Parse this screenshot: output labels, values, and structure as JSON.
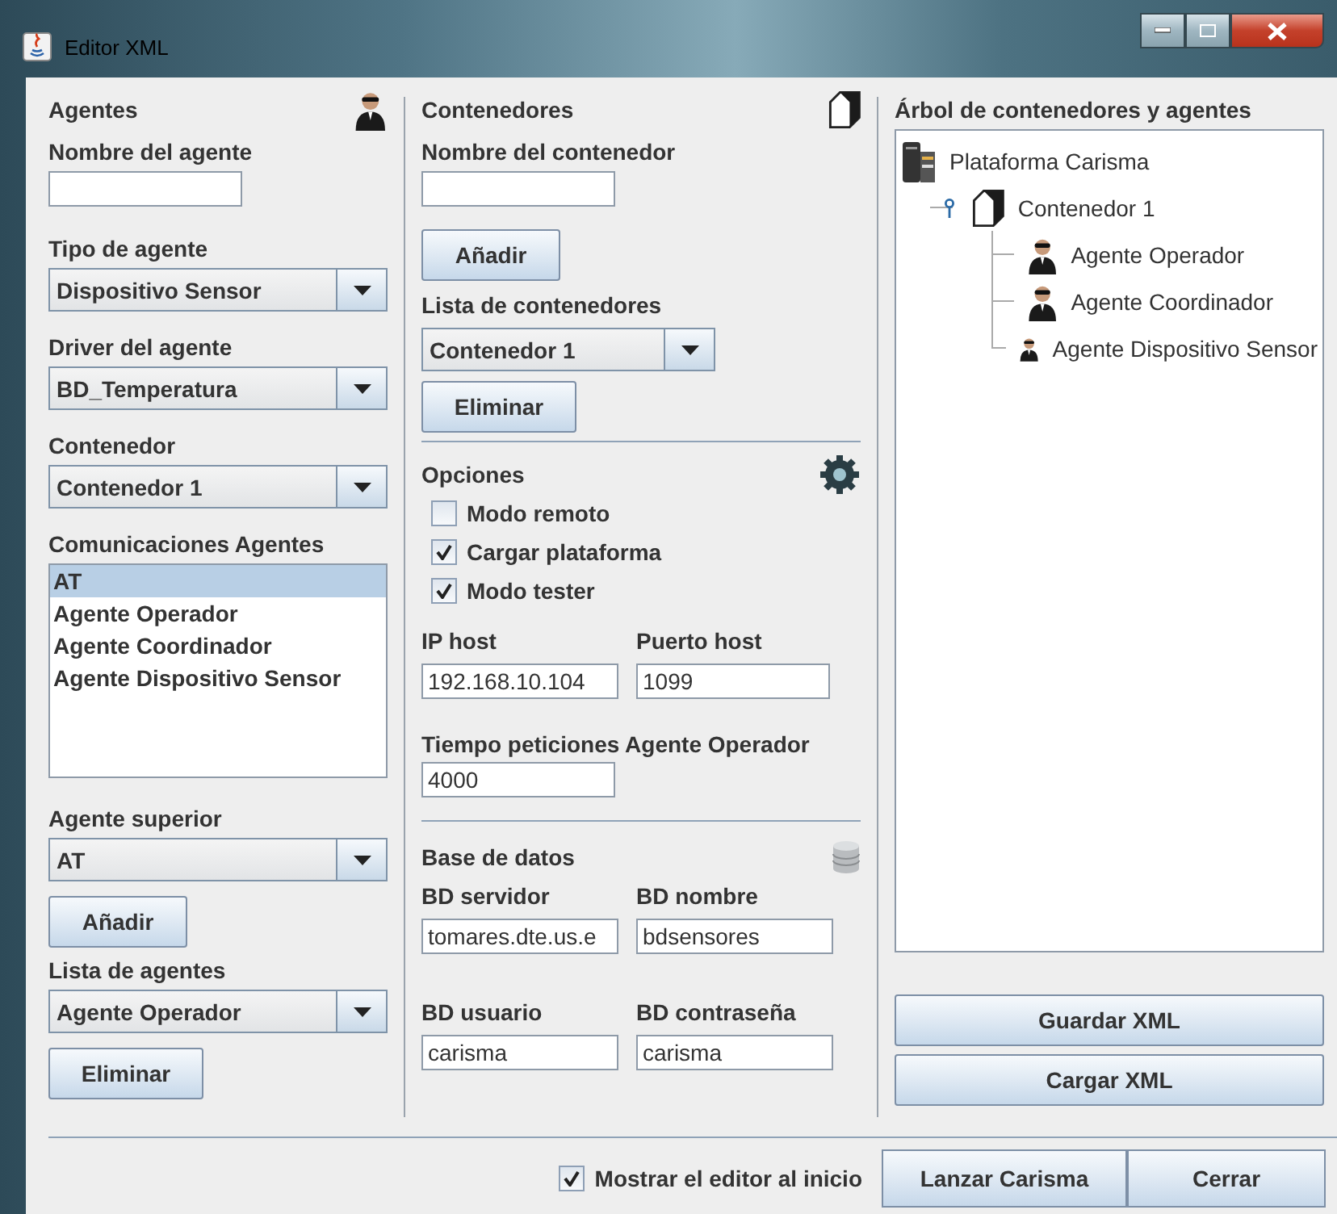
{
  "window": {
    "title": "Editor XML"
  },
  "agents": {
    "title": "Agentes",
    "name_label": "Nombre del agente",
    "type_label": "Tipo de agente",
    "type_value": "Dispositivo Sensor",
    "driver_label": "Driver del agente",
    "driver_value": "BD_Temperatura",
    "container_label": "Contenedor",
    "container_value": "Contenedor 1",
    "comms_label": "Comunicaciones Agentes",
    "comms": [
      {
        "label": "AT",
        "selected": true
      },
      {
        "label": "Agente Operador",
        "selected": false
      },
      {
        "label": "Agente Coordinador",
        "selected": false
      },
      {
        "label": "Agente Dispositivo Sensor",
        "selected": false
      }
    ],
    "superior_label": "Agente superior",
    "superior_value": "AT",
    "add_button": "Añadir",
    "list_label": "Lista de agentes",
    "list_value": "Agente Operador",
    "remove_button": "Eliminar"
  },
  "containers": {
    "title": "Contenedores",
    "name_label": "Nombre del contenedor",
    "add_button": "Añadir",
    "list_label": "Lista de contenedores",
    "list_value": "Contenedor 1",
    "remove_button": "Eliminar"
  },
  "options": {
    "title": "Opciones",
    "checks": [
      {
        "label": "Modo remoto",
        "checked": false
      },
      {
        "label": "Cargar plataforma",
        "checked": true
      },
      {
        "label": "Modo tester",
        "checked": true
      }
    ],
    "ip_label": "IP host",
    "ip_value": "192.168.10.104",
    "port_label": "Puerto host",
    "port_value": "1099",
    "timeout_label": "Tiempo peticiones Agente Operador",
    "timeout_value": "4000"
  },
  "database": {
    "title": "Base de datos",
    "fields": [
      {
        "label": "BD servidor",
        "value": "tomares.dte.us.e"
      },
      {
        "label": "BD nombre",
        "value": "bdsensores"
      },
      {
        "label": "BD usuario",
        "value": "carisma"
      },
      {
        "label": "BD contraseña",
        "value": "carisma"
      }
    ]
  },
  "tree": {
    "title": "Árbol de contenedores y agentes",
    "nodes": [
      {
        "label": "Plataforma Carisma",
        "kind": "platform",
        "children": [
          {
            "label": "Contenedor 1",
            "kind": "container",
            "expanded": true,
            "children": [
              {
                "label": "Agente Operador",
                "kind": "agent"
              },
              {
                "label": "Agente Coordinador",
                "kind": "agent"
              },
              {
                "label": "Agente Dispositivo Sensor",
                "kind": "agent"
              }
            ]
          }
        ]
      }
    ]
  },
  "actions": [
    "Guardar XML",
    "Cargar XML"
  ],
  "footer": {
    "show_on_start": {
      "label": "Mostrar el editor al inicio",
      "checked": true
    },
    "buttons": [
      "Lanzar Carisma",
      "Cerrar"
    ]
  }
}
